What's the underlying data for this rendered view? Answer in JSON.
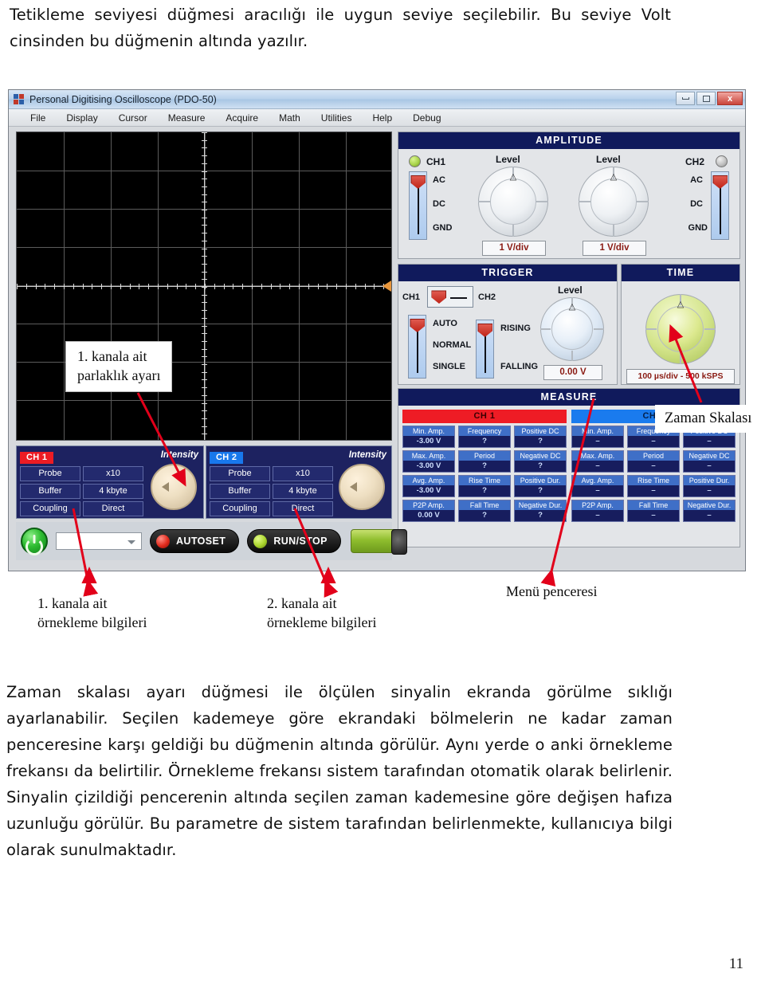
{
  "document": {
    "intro_text": "Tetikleme seviyesi düğmesi aracılığı ile uygun seviye seçilebilir. Bu seviye Volt cinsinden bu düğmenin altında yazılır.",
    "body_text": "Zaman skalası ayarı düğmesi ile ölçülen sinyalin ekranda görülme sıklığı ayarlanabilir. Seçilen kademeye göre ekrandaki bölmelerin ne kadar zaman penceresine karşı geldiği bu düğmenin altında görülür. Aynı yerde o anki örnekleme frekansı da belirtilir. Örnekleme frekansı sistem tarafından otomatik olarak belirlenir. Sinyalin çizildiği pencerenin altında seçilen zaman kademesine göre değişen hafıza uzunluğu görülür. Bu parametre de sistem tarafından belirlenmekte, kullanıcıya bilgi olarak sunulmaktadır.",
    "page_number": "11"
  },
  "annotations": {
    "brightness": "1. kanala ait\nparlaklık ayarı",
    "time_scale": "Zaman Skalası",
    "ch1_sampling": "1. kanala ait\nörnekleme bilgileri",
    "ch2_sampling": "2. kanala ait\nörnekleme bilgileri",
    "menu_window": "Menü penceresi",
    "arrow_color": "#e2001a"
  },
  "window": {
    "title": "Personal Digitising Oscilloscope (PDO-50)",
    "controls": {
      "minimize": "minimize-icon",
      "maximize": "maximize-icon",
      "close": "x"
    },
    "menu": [
      "File",
      "Display",
      "Cursor",
      "Measure",
      "Acquire",
      "Math",
      "Utilities",
      "Help",
      "Debug"
    ]
  },
  "display": {
    "columns": 8,
    "rows": 8,
    "trigger_marker_color": "#e8963c",
    "grid_color": "#5c5c5c",
    "background": "#000000"
  },
  "amplitude": {
    "title": "AMPLITUDE",
    "ch1": {
      "name": "CH1",
      "led": "on",
      "coupling_options": [
        "AC",
        "DC",
        "GND"
      ],
      "selected_coupling": "AC",
      "knob_label": "Level",
      "readout": "1 V/div"
    },
    "ch2": {
      "name": "CH2",
      "led": "off",
      "coupling_options": [
        "AC",
        "DC",
        "GND"
      ],
      "selected_coupling": "AC",
      "knob_label": "Level",
      "readout": "1 V/div"
    }
  },
  "trigger": {
    "title": "TRIGGER",
    "source_left": "CH1",
    "source_right": "CH2",
    "mode_options": [
      "AUTO",
      "NORMAL",
      "SINGLE"
    ],
    "selected_mode": "AUTO",
    "slope_options": [
      "RISING",
      "FALLING"
    ],
    "selected_slope": "RISING",
    "knob_label": "Level",
    "readout": "0.00 V"
  },
  "time": {
    "title": "TIME",
    "readout": "100 µs/div - 500 kSPS"
  },
  "measure": {
    "title": "MEASURE",
    "channels": [
      {
        "name": "CH 1",
        "header_color": "#ee1c25",
        "rows": [
          [
            {
              "label": "Min. Amp.",
              "value": "-3.00 V"
            },
            {
              "label": "Frequency",
              "value": "?"
            },
            {
              "label": "Positive DC",
              "value": "?"
            }
          ],
          [
            {
              "label": "Max. Amp.",
              "value": "-3.00 V"
            },
            {
              "label": "Period",
              "value": "?"
            },
            {
              "label": "Negative DC",
              "value": "?"
            }
          ],
          [
            {
              "label": "Avg. Amp.",
              "value": "-3.00 V"
            },
            {
              "label": "Rise Time",
              "value": "?"
            },
            {
              "label": "Positive Dur.",
              "value": "?"
            }
          ],
          [
            {
              "label": "P2P Amp.",
              "value": "0.00 V"
            },
            {
              "label": "Fall Time",
              "value": "?"
            },
            {
              "label": "Negative Dur.",
              "value": "?"
            }
          ]
        ]
      },
      {
        "name": "CH 2",
        "header_color": "#1a7bee",
        "rows": [
          [
            {
              "label": "Min. Amp.",
              "value": "–"
            },
            {
              "label": "Frequency",
              "value": "–"
            },
            {
              "label": "Positive DC",
              "value": "–"
            }
          ],
          [
            {
              "label": "Max. Amp.",
              "value": "–"
            },
            {
              "label": "Period",
              "value": "–"
            },
            {
              "label": "Negative DC",
              "value": "–"
            }
          ],
          [
            {
              "label": "Avg. Amp.",
              "value": "–"
            },
            {
              "label": "Rise Time",
              "value": "–"
            },
            {
              "label": "Positive Dur.",
              "value": "–"
            }
          ],
          [
            {
              "label": "P2P Amp.",
              "value": "–"
            },
            {
              "label": "Fall Time",
              "value": "–"
            },
            {
              "label": "Negative Dur.",
              "value": "–"
            }
          ]
        ]
      }
    ]
  },
  "channel_info": {
    "ch1": {
      "name": "CH 1",
      "badge_color": "#ec1c24",
      "settings": [
        {
          "label": "Probe",
          "value": "x10"
        },
        {
          "label": "Buffer",
          "value": "4 kbyte"
        },
        {
          "label": "Coupling",
          "value": "Direct"
        }
      ],
      "intensity_label": "Intensity"
    },
    "ch2": {
      "name": "CH 2",
      "badge_color": "#1878ec",
      "settings": [
        {
          "label": "Probe",
          "value": "x10"
        },
        {
          "label": "Buffer",
          "value": "4 kbyte"
        },
        {
          "label": "Coupling",
          "value": "Direct"
        }
      ],
      "intensity_label": "Intensity"
    }
  },
  "bottom_controls": {
    "power": "power-icon",
    "dropdown_value": "",
    "autoset": "AUTOSET",
    "run_stop": "RUN/STOP"
  }
}
